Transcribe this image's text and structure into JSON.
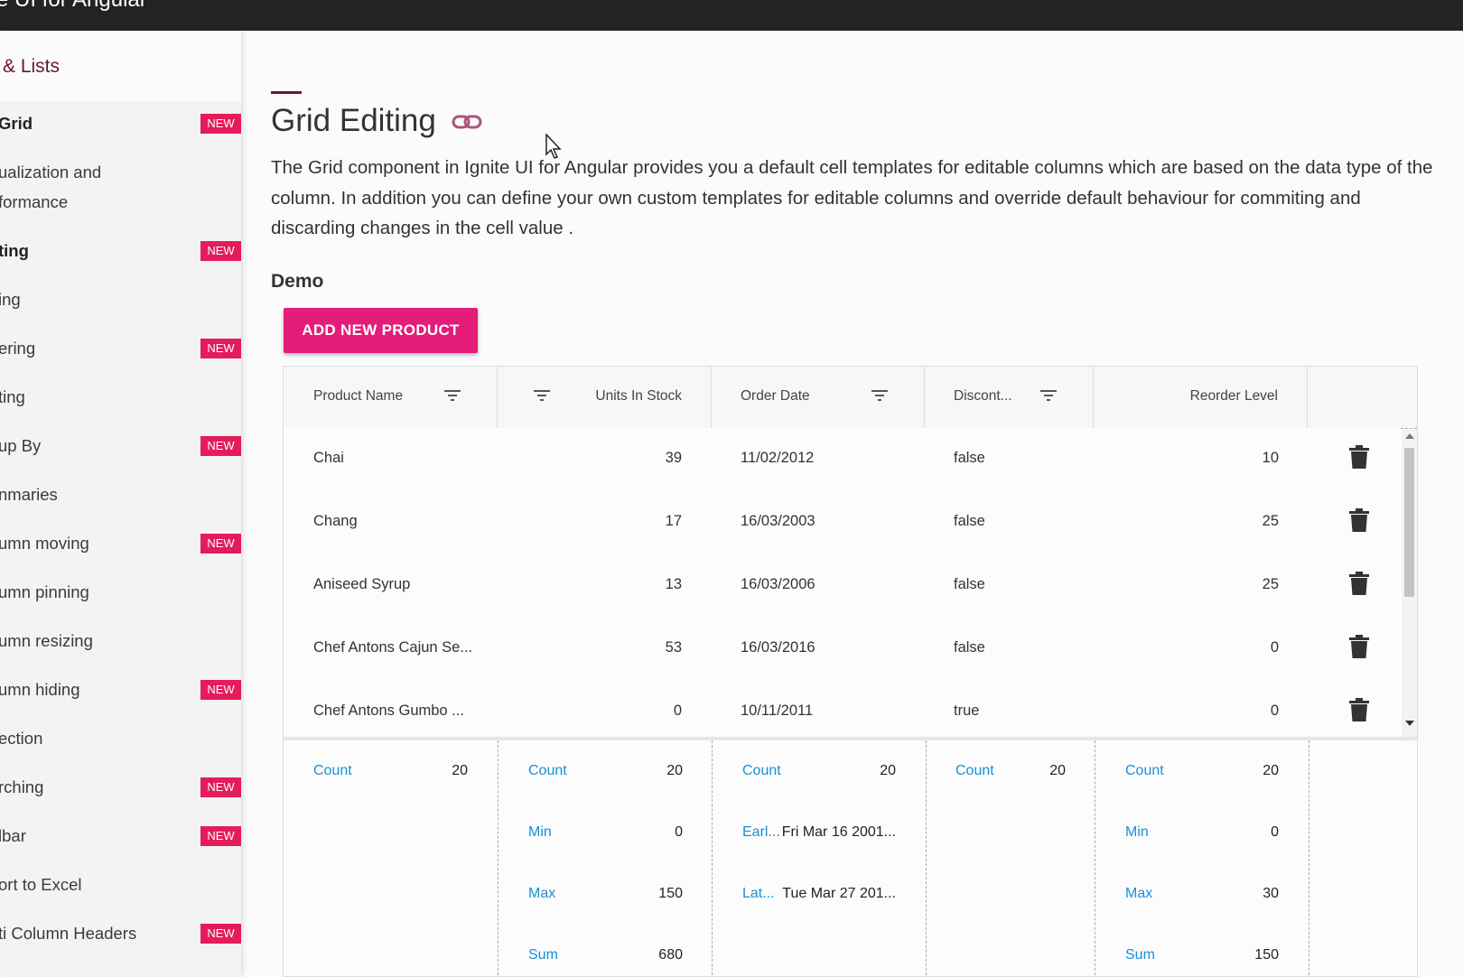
{
  "topbar": {
    "title": "e UI for Angular"
  },
  "sidebar": {
    "section_title": "& Lists",
    "items": [
      {
        "label": "Grid",
        "badge": "NEW",
        "bold": true
      },
      {
        "label": "ualization and",
        "label2": "formance",
        "badge": ""
      },
      {
        "label": "ting",
        "badge": "NEW",
        "bold": true
      },
      {
        "label": "ing",
        "badge": ""
      },
      {
        "label": "ering",
        "badge": "NEW"
      },
      {
        "label": "ting",
        "badge": ""
      },
      {
        "label": "up By",
        "badge": "NEW"
      },
      {
        "label": "nmaries",
        "badge": ""
      },
      {
        "label": "umn moving",
        "badge": "NEW"
      },
      {
        "label": "umn pinning",
        "badge": ""
      },
      {
        "label": "umn resizing",
        "badge": ""
      },
      {
        "label": "umn hiding",
        "badge": "NEW"
      },
      {
        "label": "ection",
        "badge": ""
      },
      {
        "label": "rching",
        "badge": "NEW"
      },
      {
        "label": "lbar",
        "badge": "NEW"
      },
      {
        "label": "ort to Excel",
        "badge": ""
      },
      {
        "label": "ti Column Headers",
        "badge": "NEW"
      }
    ]
  },
  "main": {
    "title": "Grid Editing",
    "description": "The Grid component in Ignite UI for Angular provides you a default cell templates for editable columns which are based on the data type of the column. In addition you can define your own custom templates for editable columns and override default behaviour for commiting and discarding changes in the cell value .",
    "demo_heading": "Demo",
    "add_button": "ADD NEW PRODUCT"
  },
  "grid": {
    "columns": [
      "Product Name",
      "Units In Stock",
      "Order Date",
      "Discont...",
      "Reorder Level"
    ],
    "rows": [
      {
        "name": "Chai",
        "units": "39",
        "date": "11/02/2012",
        "disc": "false",
        "reorder": "10"
      },
      {
        "name": "Chang",
        "units": "17",
        "date": "16/03/2003",
        "disc": "false",
        "reorder": "25"
      },
      {
        "name": "Aniseed Syrup",
        "units": "13",
        "date": "16/03/2006",
        "disc": "false",
        "reorder": "25"
      },
      {
        "name": "Chef Antons Cajun Se...",
        "units": "53",
        "date": "16/03/2016",
        "disc": "false",
        "reorder": "0"
      },
      {
        "name": "Chef Antons Gumbo ...",
        "units": "0",
        "date": "10/11/2011",
        "disc": "true",
        "reorder": "0"
      }
    ],
    "summaries": {
      "name": [
        {
          "label": "Count",
          "value": "20"
        }
      ],
      "units": [
        {
          "label": "Count",
          "value": "20"
        },
        {
          "label": "Min",
          "value": "0"
        },
        {
          "label": "Max",
          "value": "150"
        },
        {
          "label": "Sum",
          "value": "680"
        }
      ],
      "date": [
        {
          "label": "Count",
          "value": "20"
        },
        {
          "label": "Earl...",
          "value": "Fri Mar 16 2001..."
        },
        {
          "label": "Lat...",
          "value": "Tue Mar 27 201..."
        }
      ],
      "disc": [
        {
          "label": "Count",
          "value": "20"
        }
      ],
      "reorder": [
        {
          "label": "Count",
          "value": "20"
        },
        {
          "label": "Min",
          "value": "0"
        },
        {
          "label": "Max",
          "value": "30"
        },
        {
          "label": "Sum",
          "value": "150"
        }
      ]
    }
  },
  "colors": {
    "accent": "#e41c7a",
    "badge": "#e41c5b",
    "summary_label": "#1a8fd8",
    "topbar": "#232323"
  }
}
